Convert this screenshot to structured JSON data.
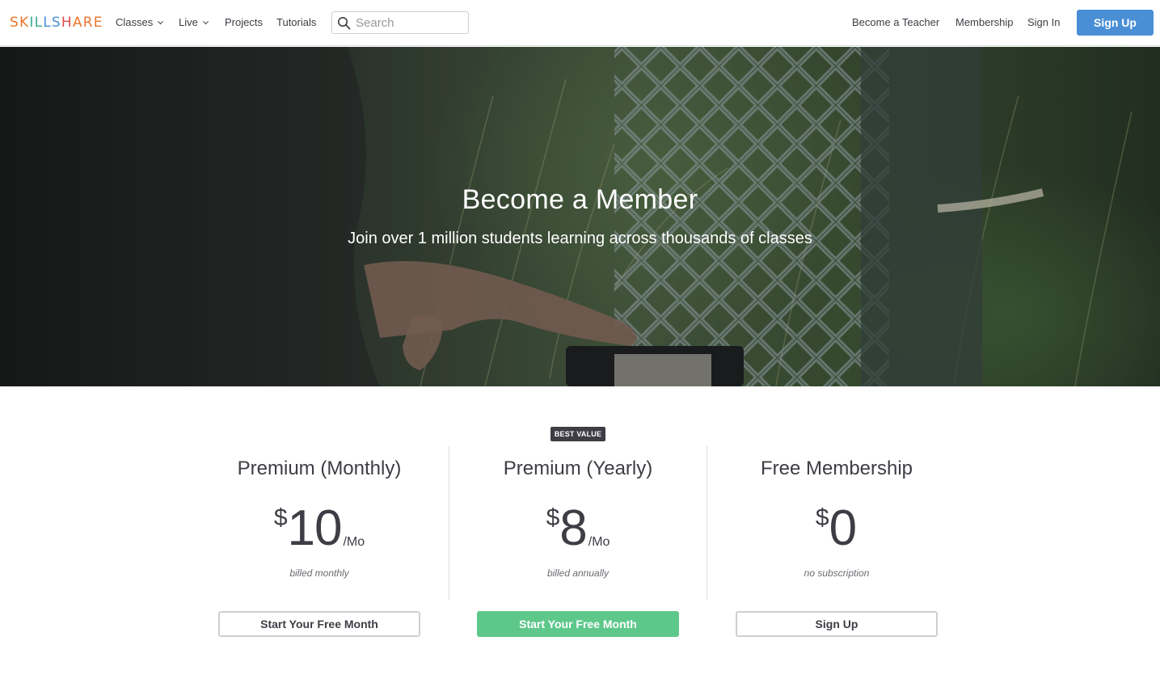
{
  "header": {
    "logo_letters": [
      {
        "ch": "S",
        "color": "#e9762b"
      },
      {
        "ch": "K",
        "color": "#e9762b"
      },
      {
        "ch": "I",
        "color": "#3aab8f"
      },
      {
        "ch": "L",
        "color": "#3aab8f"
      },
      {
        "ch": "L",
        "color": "#4a8fd6"
      },
      {
        "ch": "S",
        "color": "#4a8fd6"
      },
      {
        "ch": "H",
        "color": "#e04b4b"
      },
      {
        "ch": "A",
        "color": "#e9762b"
      },
      {
        "ch": "R",
        "color": "#e9762b"
      },
      {
        "ch": "E",
        "color": "#e9762b"
      }
    ],
    "nav": {
      "classes": "Classes",
      "live": "Live",
      "projects": "Projects",
      "tutorials": "Tutorials"
    },
    "search": {
      "placeholder": "Search",
      "value": ""
    },
    "right": {
      "become_teacher": "Become a Teacher",
      "membership": "Membership",
      "sign_in": "Sign In",
      "sign_up": "Sign Up"
    },
    "accent_color": "#4a8fd6"
  },
  "hero": {
    "title": "Become a Member",
    "subtitle": "Join over 1 million students learning across thousands of classes"
  },
  "pricing": {
    "badge": "BEST VALUE",
    "plans": [
      {
        "title": "Premium (Monthly)",
        "currency": "$",
        "amount": "10",
        "period": "/Mo",
        "billing": "billed monthly",
        "cta": "Start Your Free Month"
      },
      {
        "title": "Premium (Yearly)",
        "currency": "$",
        "amount": "8",
        "period": "/Mo",
        "billing": "billed annually",
        "cta": "Start Your Free Month"
      },
      {
        "title": "Free Membership",
        "currency": "$",
        "amount": "0",
        "period": "",
        "billing": "no subscription",
        "cta": "Sign Up"
      }
    ],
    "highlight_color": "#5ec88b"
  }
}
